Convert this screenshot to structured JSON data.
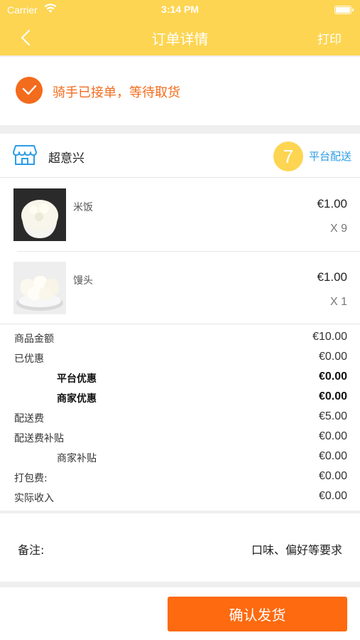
{
  "status_bar": {
    "carrier": "Carrier",
    "time": "3:14 PM"
  },
  "nav": {
    "title": "订单详情",
    "right_action": "打印"
  },
  "order_status": {
    "text": "骑手已接单，等待取货"
  },
  "shop": {
    "name": "超意兴",
    "number": "7",
    "delivery_type": "平台配送"
  },
  "items": [
    {
      "name": "米饭",
      "price": "€1.00",
      "quantity": "X 9"
    },
    {
      "name": "馒头",
      "price": "€1.00",
      "quantity": "X 1"
    }
  ],
  "fees": [
    {
      "label": "商品金额",
      "value": "€10.00"
    },
    {
      "label": "已优惠",
      "value": "€0.00"
    },
    {
      "label": "平台优惠",
      "value": "€0.00"
    },
    {
      "label": "商家优惠",
      "value": "€0.00"
    },
    {
      "label": "配送费",
      "value": "€5.00"
    },
    {
      "label": "配送费补贴",
      "value": "€0.00"
    },
    {
      "label": "商家补贴",
      "value": "€0.00"
    },
    {
      "label": "打包费:",
      "value": "€0.00"
    },
    {
      "label": "实际收入",
      "value": "€0.00"
    }
  ],
  "remark": {
    "label": "备注:",
    "value": "口味、偏好等要求"
  },
  "confirm_button": "确认发货",
  "colors": {
    "header": "#fdd552",
    "accent": "#f36b1c",
    "button": "#fd6a10",
    "link": "#2c9de6"
  }
}
